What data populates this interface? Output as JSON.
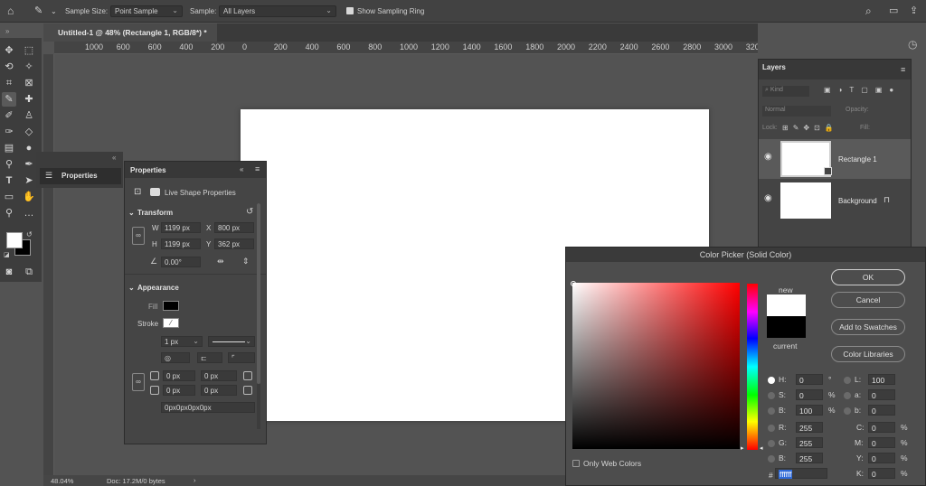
{
  "optionsbar": {
    "sample_size_label": "Sample Size:",
    "sample_size_value": "Point Sample",
    "sample_label": "Sample:",
    "sample_value": "All Layers",
    "show_ring_label": "Show Sampling Ring"
  },
  "document": {
    "tab_title": "Untitled-1 @ 48% (Rectangle 1, RGB/8*) *"
  },
  "ruler": {
    "ticks": [
      "1000",
      "600",
      "600",
      "400",
      "200",
      "0",
      "200",
      "400",
      "600",
      "800",
      "1000",
      "1200",
      "1400",
      "1600",
      "1800",
      "2000",
      "2200",
      "2400",
      "2600",
      "2800",
      "3000",
      "3200",
      "3400",
      "3600",
      "3800",
      "4000"
    ]
  },
  "collapsed_panel": {
    "label": "Properties"
  },
  "properties": {
    "title": "Properties",
    "subtitle": "Live Shape Properties",
    "transform_label": "Transform",
    "w_label": "W",
    "w_value": "1199 px",
    "x_label": "X",
    "x_value": "800 px",
    "h_label": "H",
    "h_value": "1199 px",
    "y_label": "Y",
    "y_value": "362 px",
    "angle_value": "0.00°",
    "appearance_label": "Appearance",
    "fill_label": "Fill",
    "stroke_label": "Stroke",
    "stroke_width": "1 px",
    "corner_tl": "0 px",
    "corner_tr": "0 px",
    "corner_bl": "0 px",
    "corner_br": "0 px",
    "corners_summary": "0px0px0px0px"
  },
  "layers": {
    "title": "Layers",
    "search_placeholder": "Kind",
    "blend_mode": "Normal",
    "opacity_label": "Opacity:",
    "lock_label": "Lock:",
    "fill_label": "Fill:",
    "items": [
      {
        "name": "Rectangle 1"
      },
      {
        "name": "Background"
      }
    ]
  },
  "picker": {
    "title": "Color Picker (Solid Color)",
    "new_label": "new",
    "current_label": "current",
    "ok_label": "OK",
    "cancel_label": "Cancel",
    "add_swatches_label": "Add to Swatches",
    "libraries_label": "Color Libraries",
    "only_web_label": "Only Web Colors",
    "h_label": "H:",
    "h_value": "0",
    "h_unit": "°",
    "s_label": "S:",
    "s_value": "0",
    "s_unit": "%",
    "b_label": "B:",
    "b_value": "100",
    "b_unit": "%",
    "r_label": "R:",
    "r_value": "255",
    "g_label": "G:",
    "g_value": "255",
    "bb_label": "B:",
    "bb_value": "255",
    "l_label": "L:",
    "l_value": "100",
    "a_label": "a:",
    "a_value": "0",
    "lb_label": "b:",
    "lb_value": "0",
    "c_label": "C:",
    "c_value": "0",
    "c_unit": "%",
    "m_label": "M:",
    "m_value": "0",
    "m_unit": "%",
    "yy_label": "Y:",
    "yy_value": "0",
    "yy_unit": "%",
    "k_label": "K:",
    "k_value": "0",
    "k_unit": "%",
    "hex_label": "#",
    "hex_value": "ffffff",
    "new_color": "#ffffff",
    "current_color": "#000000"
  },
  "status": {
    "zoom": "48.04%",
    "doc_info": "Doc: 17.2M/0 bytes"
  },
  "colors": {
    "accent": "#2f6ad9",
    "foreground": "#ffffff",
    "background": "#000000"
  }
}
